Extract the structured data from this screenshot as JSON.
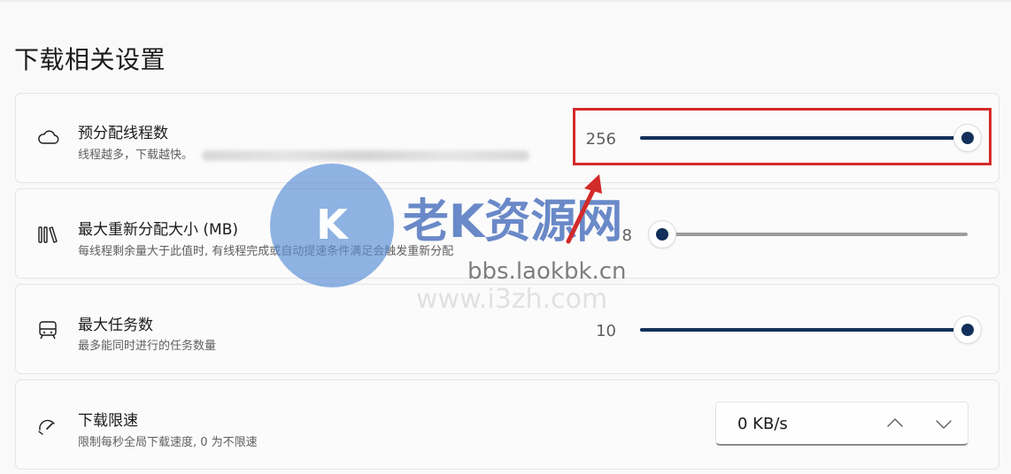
{
  "section_title": "下载相关设置",
  "settings": [
    {
      "id": "preallocate-threads",
      "icon": "cloud-icon",
      "title": "预分配线程数",
      "description": "线程越多，下载越快。",
      "value": "256",
      "slider_fraction": 1.0
    },
    {
      "id": "max-reallocation-size",
      "icon": "library-icon",
      "title": "最大重新分配大小 (MB)",
      "description": "每线程剩余量大于此值时, 有线程完成或自动提速条件满足会触发重新分配",
      "value": "8",
      "slider_fraction": 0.0
    },
    {
      "id": "max-tasks",
      "icon": "tram-icon",
      "title": "最大任务数",
      "description": "最多能同时进行的任务数量",
      "value": "10",
      "slider_fraction": 1.0
    },
    {
      "id": "speed-limit",
      "icon": "speedometer-icon",
      "title": "下载限速",
      "description": "限制每秒全局下载速度, 0 为不限速",
      "number_value": "0 KB/s"
    }
  ],
  "watermark": {
    "line1": "老K资源网",
    "line2": "bbs.laokbk.cn",
    "line3": "www.i3zh.com"
  },
  "colors": {
    "accent": "#12305a",
    "highlight": "#d32a2a",
    "track": "#9c9c9c"
  }
}
